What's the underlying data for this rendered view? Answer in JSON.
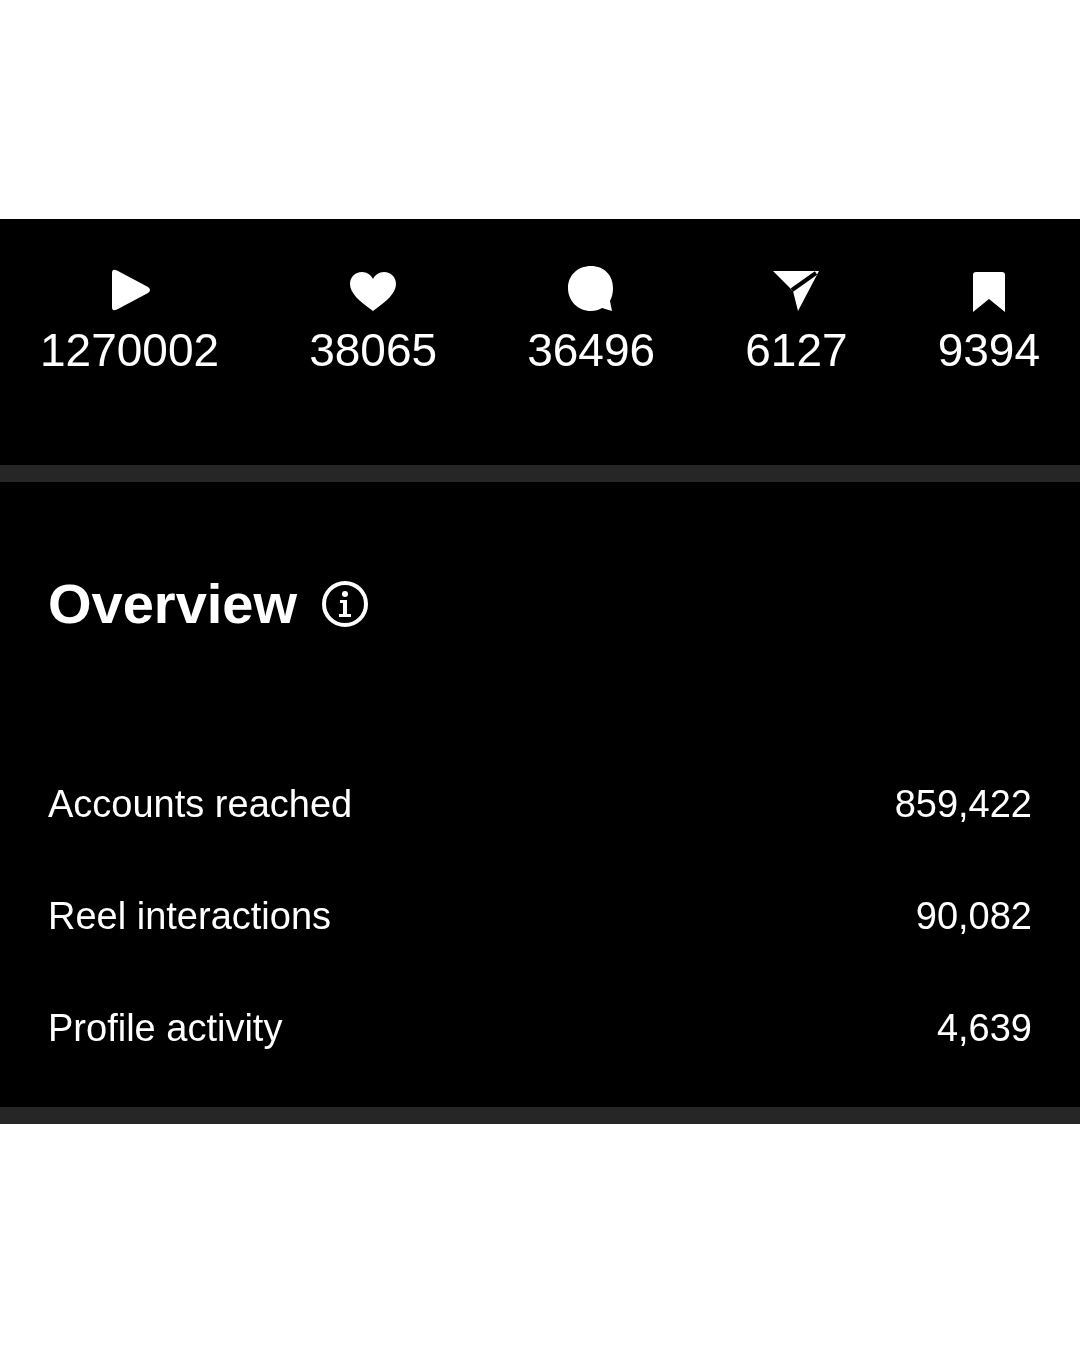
{
  "stats": [
    {
      "kind": "play",
      "value": "1270002"
    },
    {
      "kind": "heart",
      "value": "38065"
    },
    {
      "kind": "comment",
      "value": "36496"
    },
    {
      "kind": "share",
      "value": "6127"
    },
    {
      "kind": "save",
      "value": "9394"
    }
  ],
  "overview": {
    "title": "Overview",
    "rows": [
      {
        "label": "Accounts reached",
        "value": "859,422"
      },
      {
        "label": "Reel interactions",
        "value": "90,082"
      },
      {
        "label": "Profile activity",
        "value": "4,639"
      }
    ]
  }
}
